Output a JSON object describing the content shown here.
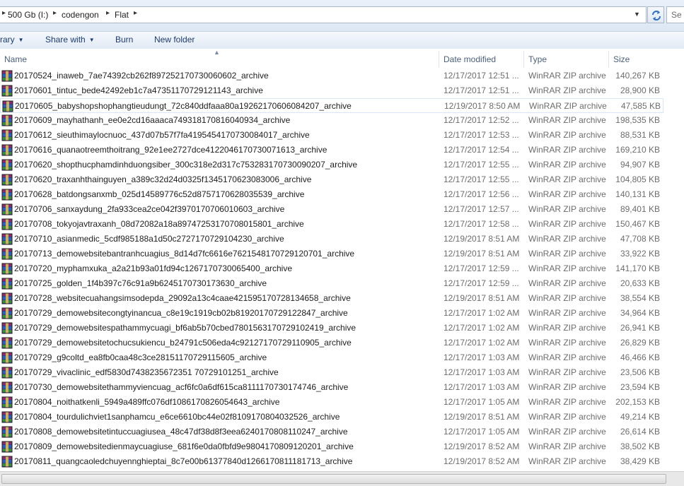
{
  "address": {
    "crumbs": [
      "500 Gb (I:)",
      "codengon",
      "Flat"
    ],
    "search_placeholder": "Se"
  },
  "toolbar": {
    "library_label": "rary",
    "share_label": "Share with",
    "burn_label": "Burn",
    "new_folder_label": "New folder"
  },
  "columns": {
    "name": "Name",
    "date": "Date modified",
    "type": "Type",
    "size": "Size"
  },
  "files": [
    {
      "name": "20170524_inaweb_7ae74392cb262f897252170730060602_archive",
      "date": "12/17/2017 12:51 ...",
      "type": "WinRAR ZIP archive",
      "size": "140,267 KB"
    },
    {
      "name": "20170601_tintuc_bede42492eb1c7a47351170729121143_archive",
      "date": "12/17/2017 12:51 ...",
      "type": "WinRAR ZIP archive",
      "size": "28,900 KB"
    },
    {
      "name": "20170605_babyshopshophangtieudungt_72c840ddfaaa80a19262170606084207_archive",
      "date": "12/19/2017 8:50 AM",
      "type": "WinRAR ZIP archive",
      "size": "47,585 KB"
    },
    {
      "name": "20170609_mayhathanh_ee0e2cd16aaaca749318170816040934_archive",
      "date": "12/17/2017 12:52 ...",
      "type": "WinRAR ZIP archive",
      "size": "198,535 KB"
    },
    {
      "name": "20170612_sieuthimaylocnuoc_437d07b57f7fa4195454170730084017_archive",
      "date": "12/17/2017 12:53 ...",
      "type": "WinRAR ZIP archive",
      "size": "88,531 KB"
    },
    {
      "name": "20170616_quanaotreemthoitrang_92e1ee2727dce4122046170730071613_archive",
      "date": "12/17/2017 12:54 ...",
      "type": "WinRAR ZIP archive",
      "size": "169,210 KB"
    },
    {
      "name": "20170620_shopthucphamdinhduongsiber_300c318e2d317c753283170730090207_archive",
      "date": "12/17/2017 12:55 ...",
      "type": "WinRAR ZIP archive",
      "size": "94,907 KB"
    },
    {
      "name": "20170620_traxanhthainguyen_a389c32d24d0325f1345170623083006_archive",
      "date": "12/17/2017 12:55 ...",
      "type": "WinRAR ZIP archive",
      "size": "104,805 KB"
    },
    {
      "name": "20170628_batdongsanxmb_025d14589776c52d8757170628035539_archive",
      "date": "12/17/2017 12:56 ...",
      "type": "WinRAR ZIP archive",
      "size": "140,131 KB"
    },
    {
      "name": "20170706_sanxaydung_2fa933cea2ce042f3970170706010603_archive",
      "date": "12/17/2017 12:57 ...",
      "type": "WinRAR ZIP archive",
      "size": "89,401 KB"
    },
    {
      "name": "20170708_tokyojavtraxanh_08d72082a18a89747253170708015801_archive",
      "date": "12/17/2017 12:58 ...",
      "type": "WinRAR ZIP archive",
      "size": "150,467 KB"
    },
    {
      "name": "20170710_asianmedic_5cdf985188a1d50c2727170729104230_archive",
      "date": "12/19/2017 8:51 AM",
      "type": "WinRAR ZIP archive",
      "size": "47,708 KB"
    },
    {
      "name": "20170713_demowebsitebantranhcuagius_8d14d7fc6616e7621548170729120701_archive",
      "date": "12/19/2017 8:51 AM",
      "type": "WinRAR ZIP archive",
      "size": "33,922 KB"
    },
    {
      "name": "20170720_myphamxuka_a2a21b93a01fd94c1267170730065400_archive",
      "date": "12/17/2017 12:59 ...",
      "type": "WinRAR ZIP archive",
      "size": "141,170 KB"
    },
    {
      "name": "20170725_golden_1f4b397c76c91a9b6245170730173630_archive",
      "date": "12/17/2017 12:59 ...",
      "type": "WinRAR ZIP archive",
      "size": "20,633 KB"
    },
    {
      "name": "20170728_websitecuahangsimsodepda_29092a13c4caae421595170728134658_archive",
      "date": "12/19/2017 8:51 AM",
      "type": "WinRAR ZIP archive",
      "size": "38,554 KB"
    },
    {
      "name": "20170729_demowebsitecongtyinancua_c8e19c1919cb02b81920170729122847_archive",
      "date": "12/17/2017 1:02 AM",
      "type": "WinRAR ZIP archive",
      "size": "34,964 KB"
    },
    {
      "name": "20170729_demowebsitespathammycuagi_bf6ab5b70cbed7801563170729102419_archive",
      "date": "12/17/2017 1:02 AM",
      "type": "WinRAR ZIP archive",
      "size": "26,941 KB"
    },
    {
      "name": "20170729_demowebsitetochucsukiencu_b24791c506eda4c92127170729110905_archive",
      "date": "12/17/2017 1:02 AM",
      "type": "WinRAR ZIP archive",
      "size": "26,829 KB"
    },
    {
      "name": "20170729_g9coltd_ea8fb0caa48c3ce28151170729115605_archive",
      "date": "12/17/2017 1:03 AM",
      "type": "WinRAR ZIP archive",
      "size": "46,466 KB"
    },
    {
      "name": "20170729_vivaclinic_edf5830d7438235672351 70729101251_archive",
      "date": "12/17/2017 1:03 AM",
      "type": "WinRAR ZIP archive",
      "size": "23,506 KB"
    },
    {
      "name": "20170730_demowebsitethammyviencuag_acf6fc0a6df615ca8111170730174746_archive",
      "date": "12/17/2017 1:03 AM",
      "type": "WinRAR ZIP archive",
      "size": "23,594 KB"
    },
    {
      "name": "20170804_noithatkenli_5949a489ffc076df1086170826054643_archive",
      "date": "12/17/2017 1:05 AM",
      "type": "WinRAR ZIP archive",
      "size": "202,153 KB"
    },
    {
      "name": "20170804_tourdulichviet1sanphamcu_e6ce6610bc44e02f8109170804032526_archive",
      "date": "12/19/2017 8:51 AM",
      "type": "WinRAR ZIP archive",
      "size": "49,214 KB"
    },
    {
      "name": "20170808_demowebsitetintuccuagiusea_48c47df38d8f3eea6240170808110247_archive",
      "date": "12/17/2017 1:05 AM",
      "type": "WinRAR ZIP archive",
      "size": "26,614 KB"
    },
    {
      "name": "20170809_demowebsitedienmaycuagiuse_681f6e0da0fbfd9e9804170809120201_archive",
      "date": "12/19/2017 8:52 AM",
      "type": "WinRAR ZIP archive",
      "size": "38,502 KB"
    },
    {
      "name": "20170811_quangcaoledchuyennghieptai_8c7e00b61377840d1266170811181713_archive",
      "date": "12/19/2017 8:52 AM",
      "type": "WinRAR ZIP archive",
      "size": "38,429 KB"
    }
  ],
  "selected_index": 2
}
